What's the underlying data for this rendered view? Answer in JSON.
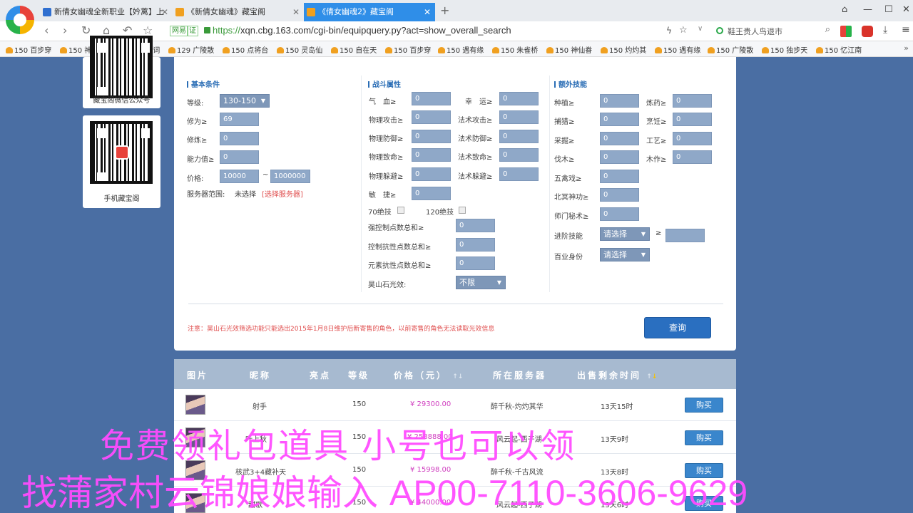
{
  "browser": {
    "tabs": [
      {
        "title": "新倩女幽魂全新职业【妗蓠】上",
        "favicon_color": "#2f6fd0"
      },
      {
        "title": "《新倩女幽魂》藏宝阁",
        "favicon_color": "#f0a020"
      },
      {
        "title": "《倩女幽魂2》藏宝阁",
        "favicon_color": "#f0a020",
        "active": true
      }
    ],
    "new_tab": "+",
    "window_controls": [
      "⌂",
      "—",
      "☐",
      "✕"
    ],
    "address": {
      "tag_shop": "网易",
      "tag_cert": "证",
      "protocol": "https://",
      "url": "xqn.cbg.163.com/cgi-bin/equipquery.py?act=show_overall_search",
      "search_text": "鞋王贵人鸟退市"
    },
    "bookmarks": [
      "150 百步穿",
      "150 神雕侠",
      "150 兰若词",
      "129 广陵散",
      "150 点将台",
      "150 灵岛仙",
      "150 自在天",
      "150 百步穿",
      "150 遇有缘",
      "150 朱雀桥",
      "150 神仙眷",
      "150 灼灼其",
      "150 遇有缘",
      "150 广陵散",
      "150 独步天",
      "150 忆江南"
    ],
    "bookmarks_more": "»"
  },
  "sidebar": {
    "wechat_label": "藏宝阁微信公众号",
    "mobile_label": "手机藏宝阁"
  },
  "search": {
    "basic": {
      "title": "基本条件",
      "level_label": "等级:",
      "level_value": "130-150",
      "xiuwei_label": "修为≥",
      "xiuwei_value": "69",
      "xiulian_label": "修炼≥",
      "xiulian_value": "0",
      "ability_label": "能力值≥",
      "ability_value": "0",
      "price_label": "价格:",
      "price_min": "10000",
      "price_sep": "~",
      "price_max": "1000000",
      "server_label": "服务器范围:",
      "server_value": "未选择",
      "server_link": "[选择服务器]"
    },
    "combat": {
      "title": "战斗属性",
      "fields": [
        {
          "label": "气　血≥",
          "value": "0"
        },
        {
          "label": "幸　运≥",
          "value": "0"
        },
        {
          "label": "物理攻击≥",
          "value": "0"
        },
        {
          "label": "法术攻击≥",
          "value": "0"
        },
        {
          "label": "物理防御≥",
          "value": "0"
        },
        {
          "label": "法术防御≥",
          "value": "0"
        },
        {
          "label": "物理致命≥",
          "value": "0"
        },
        {
          "label": "法术致命≥",
          "value": "0"
        },
        {
          "label": "物理躲避≥",
          "value": "0"
        },
        {
          "label": "法术躲避≥",
          "value": "0"
        },
        {
          "label": "敏　捷≥",
          "value": "0"
        }
      ],
      "skill70": "70绝技",
      "skill120": "120绝技",
      "control_label": "强控制点数总和≥",
      "control_value": "0",
      "resist_label": "控制抗性点数总和≥",
      "resist_value": "0",
      "element_label": "元素抗性点数总和≥",
      "element_value": "0",
      "kunshan_label": "昊山石光效:",
      "kunshan_value": "不限"
    },
    "extra": {
      "title": "额外技能",
      "fields": [
        {
          "label": "种植≥",
          "value": "0"
        },
        {
          "label": "炼药≥",
          "value": "0"
        },
        {
          "label": "捕猎≥",
          "value": "0"
        },
        {
          "label": "烹饪≥",
          "value": "0"
        },
        {
          "label": "采掘≥",
          "value": "0"
        },
        {
          "label": "工艺≥",
          "value": "0"
        },
        {
          "label": "伐木≥",
          "value": "0"
        },
        {
          "label": "木作≥",
          "value": "0"
        }
      ],
      "wuqin_label": "五禽戏≥",
      "wuqin_value": "0",
      "beiming_label": "北冥神功≥",
      "beiming_value": "0",
      "shimen_label": "师门秘术≥",
      "shimen_value": "0",
      "advanced_label": "进阶技能",
      "advanced_value": "请选择",
      "advanced_gte": "≥",
      "baiye_label": "百业身份",
      "baiye_value": "请选择"
    },
    "notice": "注意：昊山石光效筛选功能只能选出2015年1月8日维护后新寄售的角色，以前寄售的角色无法读取光效信息",
    "query_button": "查询"
  },
  "results": {
    "headers": {
      "image": "图片",
      "nickname": "昵称",
      "highlight": "亮点",
      "level": "等级",
      "price": "价格（元）",
      "server": "所在服务器",
      "time_left": "出售剩余时间"
    },
    "sort_up": "↑",
    "sort_down": "↓",
    "buy_label": "购买",
    "rows": [
      {
        "nickname": "射手",
        "level": "150",
        "price": "¥ 29300.00",
        "server": "醉千秋-灼灼其华",
        "time_left": "13天15时"
      },
      {
        "nickname": "叶上秋",
        "level": "150",
        "price": "¥ 258888.00",
        "server": "风云起-西子湖",
        "time_left": "13天9时"
      },
      {
        "nickname": "核武3+4藏补天",
        "level": "150",
        "price": "¥ 15998.00",
        "server": "醉千秋-千古风流",
        "time_left": "13天8时"
      },
      {
        "nickname": "甜歌",
        "level": "150",
        "price": "¥ 44000.00",
        "server": "风云起-西子湖",
        "time_left": "13天6时"
      }
    ]
  },
  "overlay": {
    "line1": "免费领礼包道具 小号也可以领",
    "line2_prefix": "找蒲家村云锦娘娘输入 ",
    "line2_code": "AP00-7110-3606-9629"
  }
}
